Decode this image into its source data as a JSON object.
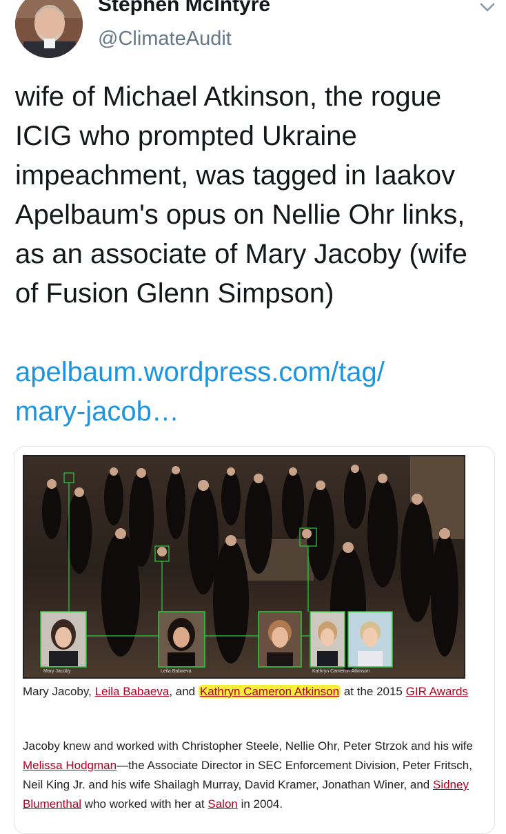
{
  "author": {
    "name": "Stephen McIntyre",
    "handle": "@ClimateAudit"
  },
  "tweet": {
    "text": "wife of Michael Atkinson, the rogue ICIG who prompted Ukraine impeachment, was tagged in Iaakov Apelbaum's opus on Nellie Ohr links, as an associate of Mary Jacoby (wife of Fusion Glenn Simpson)",
    "link_line1": "apelbaum.wordpress.com/tag/",
    "link_line2": "mary-jacob…"
  },
  "card": {
    "photo_labels": {
      "mary": "Mary Jacoby",
      "leila": "Leila Babaeva",
      "kathryn": "Kathryn Cameron Atkinson"
    },
    "caption": {
      "name1": "Mary Jacoby, ",
      "link1": "Leila Babaeva",
      "sep": ", and ",
      "link2": "Kathryn Cameron Atkinson",
      "mid": " at the 2015 ",
      "link3": "GIR Awards"
    },
    "body": {
      "t1": "Jacoby knew and worked with Christopher Steele, Nellie Ohr, Peter Strzok and his wife ",
      "link1": "Melissa Hodgman",
      "t2": "—the Associate Director in SEC Enforcement Division, Peter Fritsch, Neil King Jr. and his wife Shailagh Murray, David Kramer, Jonathan Winer, and ",
      "link2": "Sidney Blumenthal",
      "t3": " who worked with her at ",
      "link3": "Salon",
      "t4": " in 2004."
    }
  },
  "colors": {
    "link_blue": "#1b95e0",
    "link_red": "#b00020",
    "highlight": "#f7f03a",
    "tag_box_green": "#2ecc40"
  },
  "icons": [
    "chevron-down-icon",
    "avatar"
  ]
}
